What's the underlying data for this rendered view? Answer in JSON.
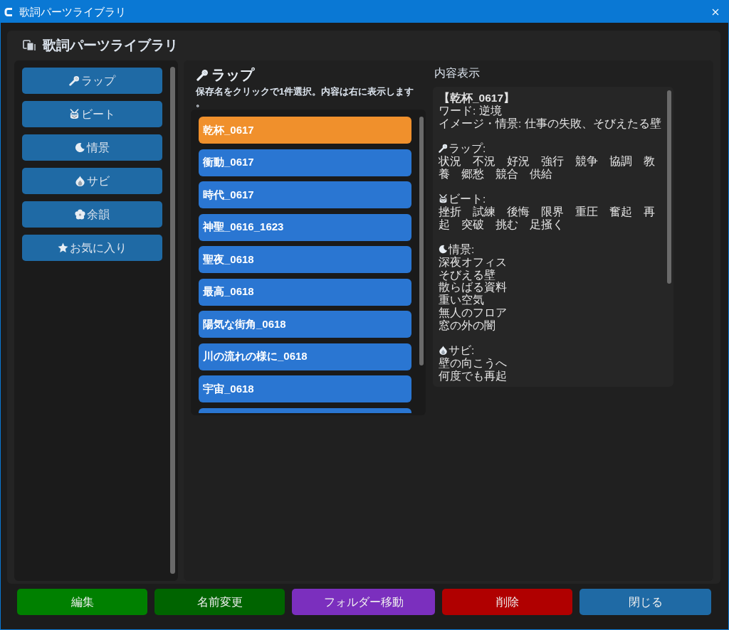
{
  "window": {
    "title": "歌詞パーツライブラリ"
  },
  "header": {
    "title": "歌詞パーツライブラリ"
  },
  "categories": [
    {
      "label": "ラップ",
      "kind": "microphone"
    },
    {
      "label": "ビート",
      "kind": "drum"
    },
    {
      "label": "情景",
      "kind": "moon"
    },
    {
      "label": "サビ",
      "kind": "flame"
    },
    {
      "label": "余韻",
      "kind": "flower"
    },
    {
      "label": "お気に入り",
      "kind": "star"
    }
  ],
  "list_panel": {
    "title": "ラップ",
    "kind": "microphone",
    "hint": "保存名をクリックで1件選択。内容は右に表示します。",
    "items": [
      {
        "label": "乾杯_0617",
        "selected": true
      },
      {
        "label": "衝動_0617",
        "selected": false
      },
      {
        "label": "時代_0617",
        "selected": false
      },
      {
        "label": "神聖_0616_1623",
        "selected": false
      },
      {
        "label": "聖夜_0618",
        "selected": false
      },
      {
        "label": "最高_0618",
        "selected": false
      },
      {
        "label": "陽気な街角_0618",
        "selected": false
      },
      {
        "label": "川の流れの様に_0618",
        "selected": false
      },
      {
        "label": "宇宙_0618",
        "selected": false
      },
      {
        "selected": false
      }
    ]
  },
  "content": {
    "heading": "内容表示",
    "title": "【乾杯_0617】",
    "fields": [
      "ワード: 逆境",
      "イメージ・情景: 仕事の失敗、そびえたる壁"
    ],
    "sections": [
      {
        "kind": "microphone",
        "label": "ラップ:",
        "lines": [
          "状況　不況　好況　強行　競争　協調　教養　郷愁　競合　供給"
        ]
      },
      {
        "kind": "drum",
        "label": "ビート:",
        "lines": [
          "挫折　試練　後悔　限界　重圧　奮起　再起　突破　挑む　足掻く"
        ]
      },
      {
        "kind": "moon",
        "label": "情景:",
        "lines": [
          "深夜オフィス",
          "そびえる壁",
          "散らばる資料",
          "重い空気",
          "無人のフロア",
          "窓の外の闇"
        ]
      },
      {
        "kind": "flame",
        "label": "サビ:",
        "lines": [
          "壁の向こうへ",
          "何度でも再起"
        ]
      }
    ]
  },
  "buttons": [
    {
      "label": "編集",
      "color": "#008000"
    },
    {
      "label": "名前変更",
      "color": "#006400"
    },
    {
      "label": "フォルダー移動",
      "color": "#7b2fbe"
    },
    {
      "label": "削除",
      "color": "#b00000"
    },
    {
      "label": "閉じる",
      "color": "#1f6aa5"
    }
  ]
}
